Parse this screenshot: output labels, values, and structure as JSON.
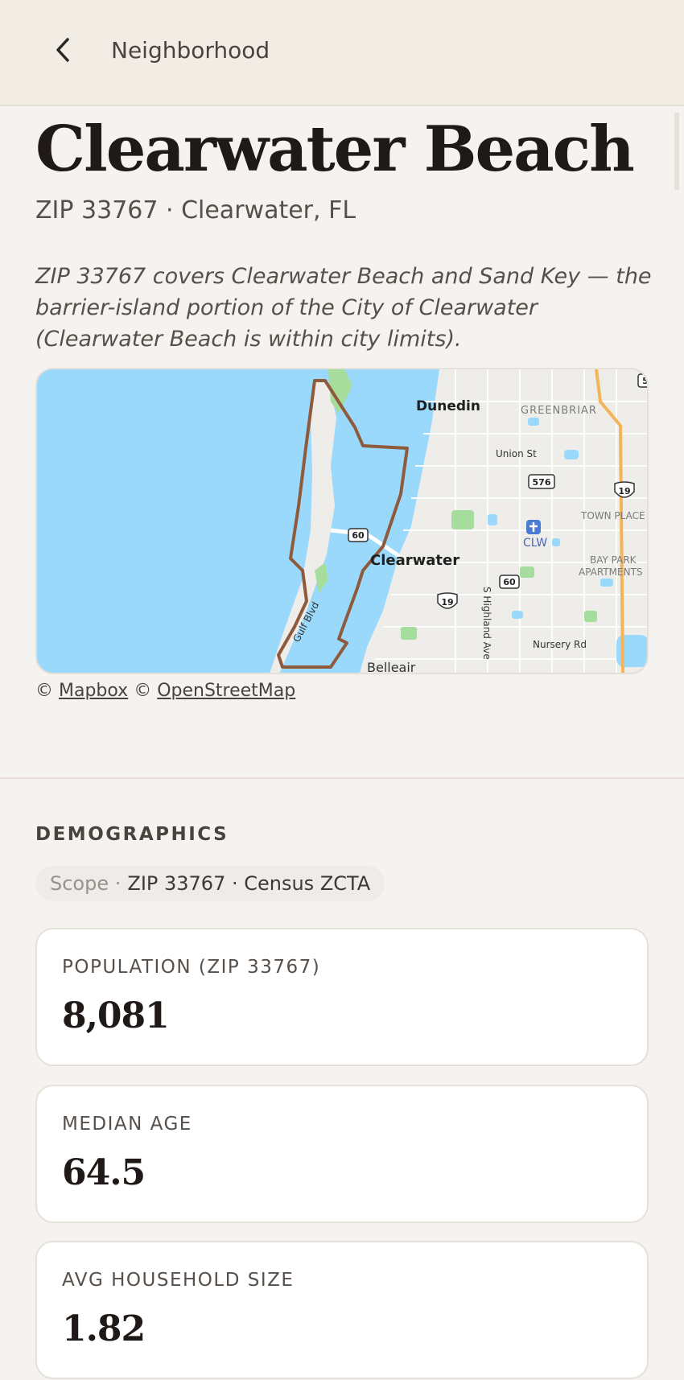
{
  "header": {
    "title": "Neighborhood"
  },
  "page": {
    "title": "Clearwater Beach",
    "subtitle": "ZIP 33767 · Clearwater, FL",
    "description": "ZIP 33767 covers Clearwater Beach and Sand Key — the barrier-island portion of the City of Clearwater (Clearwater Beach is within city limits)."
  },
  "map": {
    "labels": {
      "dunedin": "Dunedin",
      "greenbriar": "GREENBRIAR",
      "union_st": "Union St",
      "route_576": "576",
      "route_19_top": "19",
      "town_place": "TOWN PLACE",
      "clw": "CLW",
      "clearwater": "Clearwater",
      "bay_park_1": "BAY PARK",
      "bay_park_2": "APARTMENTS",
      "route_60_west": "60",
      "route_60_east": "60",
      "route_19_bottom": "19",
      "highland": "S Highland Ave",
      "gulf_blvd": "Gulf Blvd",
      "nursery_rd": "Nursery Rd",
      "belleair": "Belleair",
      "corner_shield": "5"
    },
    "colors": {
      "water": "#9ad9fb",
      "land": "#efedea",
      "boundary": "#8f5a3c",
      "park": "#a6dd9c",
      "highway": "#f4b459"
    }
  },
  "attribution": {
    "prefix": "©",
    "mapbox": "Mapbox",
    "separator": "©",
    "osm": "OpenStreetMap"
  },
  "demographics": {
    "heading": "DEMOGRAPHICS",
    "scope_label": "Scope ·",
    "scope_value": "ZIP 33767 · Census ZCTA",
    "stats": [
      {
        "label": "POPULATION (ZIP 33767)",
        "value": "8,081"
      },
      {
        "label": "MEDIAN AGE",
        "value": "64.5"
      },
      {
        "label": "AVG HOUSEHOLD SIZE",
        "value": "1.82"
      }
    ]
  }
}
